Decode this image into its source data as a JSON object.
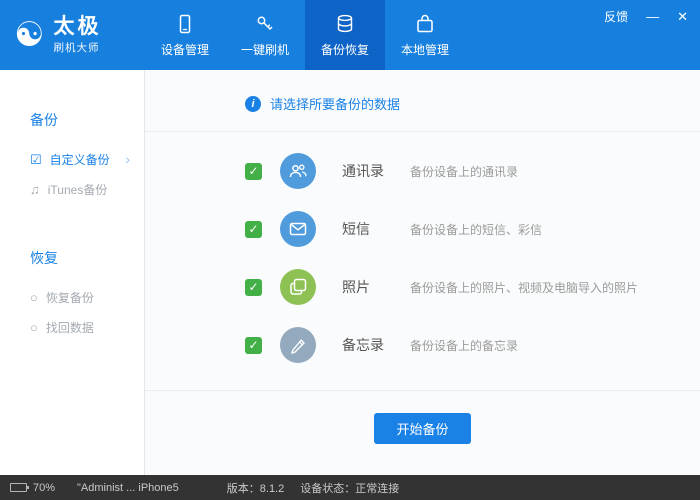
{
  "window_controls": {
    "feedback": "反馈",
    "minimize": "—",
    "close": "✕"
  },
  "titlebar": {
    "app_name": "太极",
    "app_subtitle": "刷机大师",
    "tabs": [
      {
        "label": "设备管理",
        "icon": "device-icon",
        "active": false
      },
      {
        "label": "一键刷机",
        "icon": "key-icon",
        "active": false
      },
      {
        "label": "备份恢复",
        "icon": "database-icon",
        "active": true
      },
      {
        "label": "本地管理",
        "icon": "briefcase-icon",
        "active": false
      }
    ]
  },
  "sidebar": {
    "sections": [
      {
        "title": "备份",
        "items": [
          {
            "label": "自定义备份",
            "active": true,
            "icon": "checkbox-icon"
          },
          {
            "label": "iTunes备份",
            "active": false,
            "icon": "music-note-icon"
          }
        ]
      },
      {
        "title": "恢复",
        "items": [
          {
            "label": "恢复备份",
            "active": false,
            "icon": "circle-icon"
          },
          {
            "label": "找回数据",
            "active": false,
            "icon": "circle-icon"
          }
        ]
      }
    ]
  },
  "main": {
    "notice": "请选择所要备份的数据",
    "items": [
      {
        "name": "通讯录",
        "desc": "备份设备上的通讯录",
        "checked": true,
        "icon": "contacts-icon",
        "icon_color": "#4f9bdc"
      },
      {
        "name": "短信",
        "desc": "备份设备上的短信、彩信",
        "checked": true,
        "icon": "sms-icon",
        "icon_color": "#4f9bdc"
      },
      {
        "name": "照片",
        "desc": "备份设备上的照片、视频及电脑导入的照片",
        "checked": true,
        "icon": "photos-icon",
        "icon_color": "#8dc153"
      },
      {
        "name": "备忘录",
        "desc": "备份设备上的备忘录",
        "checked": true,
        "icon": "memo-icon",
        "icon_color": "#93a9bd"
      }
    ],
    "start_button": "开始备份"
  },
  "statusbar": {
    "battery": "70%",
    "device": "\"Administ ... iPhone5",
    "version": "版本：8.1.2",
    "status": "设备状态：正常连接"
  },
  "icons": {
    "logo": "☯",
    "checkbox_checked": "☑",
    "music_note": "♫",
    "radio_circle": "○",
    "chevron_right": "›",
    "check": "✓",
    "info": "i"
  },
  "colors": {
    "topbar": "#1780de",
    "active_tab": "#0d63c6",
    "accent": "#1a82e6",
    "checkbox_green": "#42b046",
    "statusbar": "#333333"
  }
}
